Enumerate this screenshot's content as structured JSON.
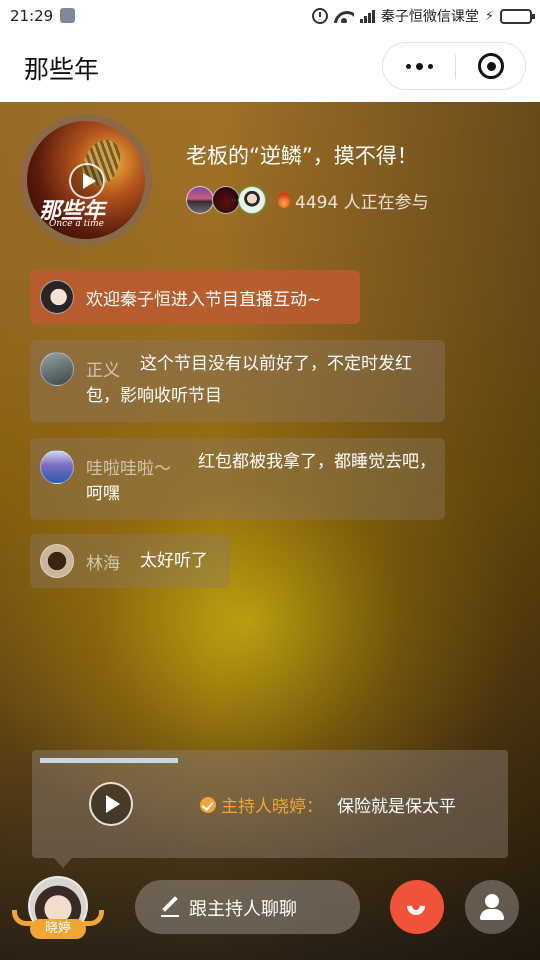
{
  "status_bar": {
    "time": "21:29",
    "carrier": "秦子恒微信课堂",
    "icons": [
      "app-notification-icon",
      "alarm-icon",
      "wifi-icon",
      "signal-icon",
      "charging-icon",
      "battery-icon"
    ]
  },
  "nav": {
    "title": "那些年",
    "more_icon": "more-dots-icon",
    "close_icon": "target-close-icon"
  },
  "program": {
    "cover_title": "那些年",
    "cover_subtitle": "Once a time",
    "title": "老板的“逆鳞”，摸不得！",
    "participants_count": "4494 人正在参与",
    "participant_avatars": 3
  },
  "chat": {
    "welcome": "欢迎秦子恒进入节目直播互动~",
    "messages": [
      {
        "name": "正义",
        "content": "这个节目没有以前好了，不定时发红包，影响收听节目"
      },
      {
        "name": "哇啦哇啦～",
        "content": "红包都被我拿了，都睡觉去吧，呵嘿"
      },
      {
        "name": "林海",
        "content": "太好听了"
      }
    ]
  },
  "host_card": {
    "host_label": "主持人晓婷：",
    "quote": "保险就是保太平",
    "audio_progress": 0.3
  },
  "bottom": {
    "host_name": "晓婷",
    "chat_button": "跟主持人聊聊",
    "colors": {
      "accent": "#f2a434",
      "call": "#f0523a",
      "welcome_bubble": "#be5a30"
    }
  }
}
